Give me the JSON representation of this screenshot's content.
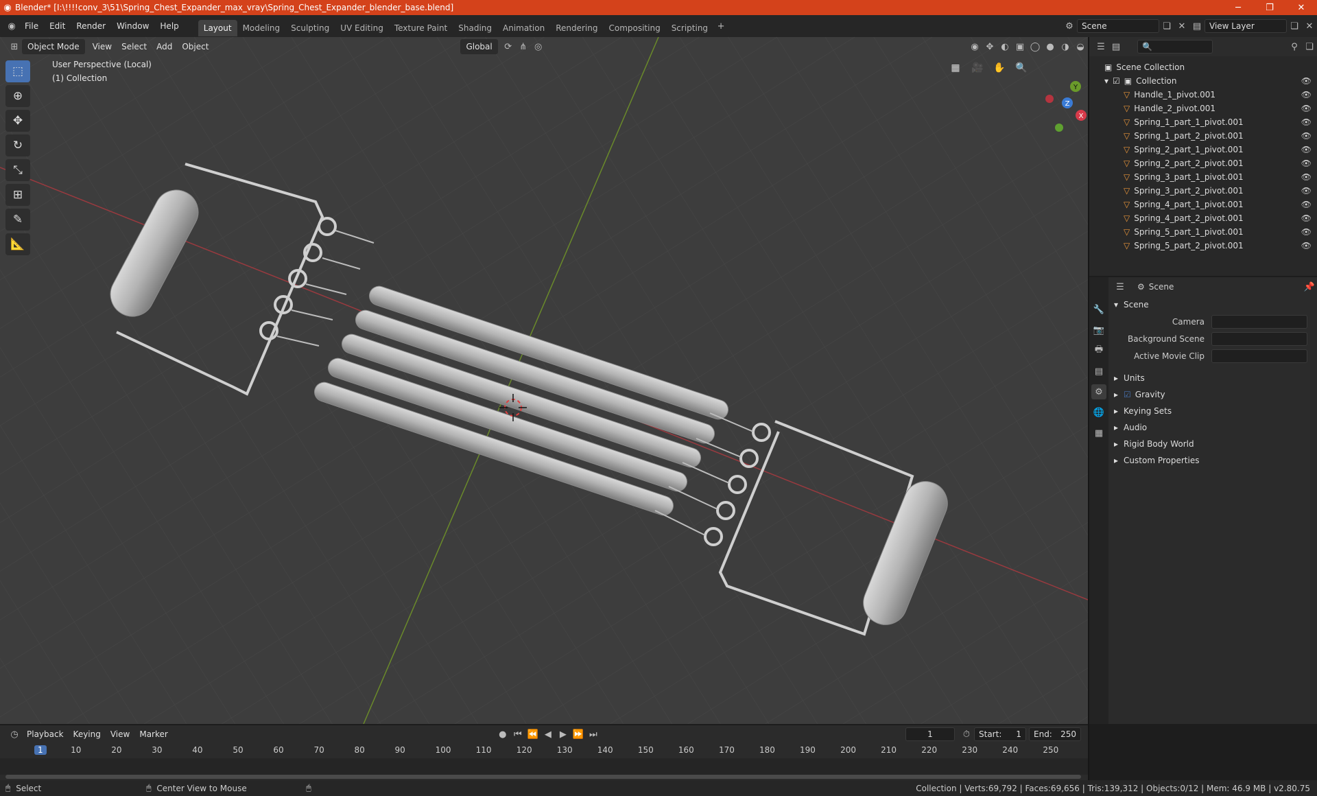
{
  "window": {
    "title": "Blender* [I:\\!!!!conv_3\\51\\Spring_Chest_Expander_max_vray\\Spring_Chest_Expander_blender_base.blend]"
  },
  "menu": [
    "File",
    "Edit",
    "Render",
    "Window",
    "Help"
  ],
  "workspaces": [
    "Layout",
    "Modeling",
    "Sculpting",
    "UV Editing",
    "Texture Paint",
    "Shading",
    "Animation",
    "Rendering",
    "Compositing",
    "Scripting"
  ],
  "active_workspace": "Layout",
  "scene_selector": {
    "value": "Scene",
    "view_layer": "View Layer"
  },
  "viewport": {
    "mode": "Object Mode",
    "menus": [
      "View",
      "Select",
      "Add",
      "Object"
    ],
    "transform": "Global",
    "info_line1": "User Perspective (Local)",
    "info_line2": "(1) Collection",
    "gizmo": {
      "x": "X",
      "y": "Y",
      "z": "Z"
    }
  },
  "outliner": {
    "root": "Scene Collection",
    "collection": "Collection",
    "objects": [
      "Handle_1_pivot.001",
      "Handle_2_pivot.001",
      "Spring_1_part_1_pivot.001",
      "Spring_1_part_2_pivot.001",
      "Spring_2_part_1_pivot.001",
      "Spring_2_part_2_pivot.001",
      "Spring_3_part_1_pivot.001",
      "Spring_3_part_2_pivot.001",
      "Spring_4_part_1_pivot.001",
      "Spring_4_part_2_pivot.001",
      "Spring_5_part_1_pivot.001",
      "Spring_5_part_2_pivot.001"
    ]
  },
  "properties": {
    "header": "Scene",
    "section": "Scene",
    "fields": [
      {
        "label": "Camera",
        "value": ""
      },
      {
        "label": "Background Scene",
        "value": ""
      },
      {
        "label": "Active Movie Clip",
        "value": ""
      }
    ],
    "panels": [
      "Units",
      "Gravity",
      "Keying Sets",
      "Audio",
      "Rigid Body World",
      "Custom Properties"
    ],
    "gravity_checked": true
  },
  "timeline": {
    "menus": [
      "Playback",
      "Keying",
      "View",
      "Marker"
    ],
    "current_frame": "1",
    "start_label": "Start:",
    "start": "1",
    "end_label": "End:",
    "end": "250",
    "ticks": [
      "1",
      "10",
      "20",
      "30",
      "40",
      "50",
      "60",
      "70",
      "80",
      "90",
      "100",
      "110",
      "120",
      "130",
      "140",
      "150",
      "160",
      "170",
      "180",
      "190",
      "200",
      "210",
      "220",
      "230",
      "240",
      "250"
    ]
  },
  "statusbar": {
    "left": "Select",
    "middle": "Center View to Mouse",
    "right": "Collection | Verts:69,792 | Faces:69,656 | Tris:139,312 | Objects:0/12 | Mem: 46.9 MB | v2.80.75"
  }
}
